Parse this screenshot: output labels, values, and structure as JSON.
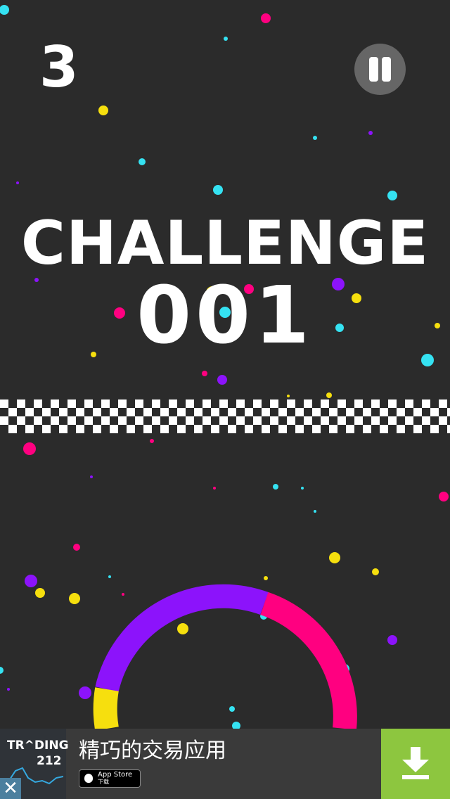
{
  "hud": {
    "score": "3",
    "pause_icon": "pause-icon"
  },
  "challenge": {
    "title": "CHALLENGE",
    "number": "001"
  },
  "colors": {
    "background": "#2b2b2b",
    "cyan": "#35e2f2",
    "yellow": "#f6df0e",
    "purple": "#8c13fb",
    "pink": "#ff0080",
    "ad_green": "#8dc63f"
  },
  "ad": {
    "brand": "TR^DING",
    "brand_number": "212",
    "headline": "精巧的交易应用",
    "store_line1": "App Store",
    "store_line2": "下载",
    "close_icon": "close-icon",
    "download_icon": "download-icon"
  }
}
